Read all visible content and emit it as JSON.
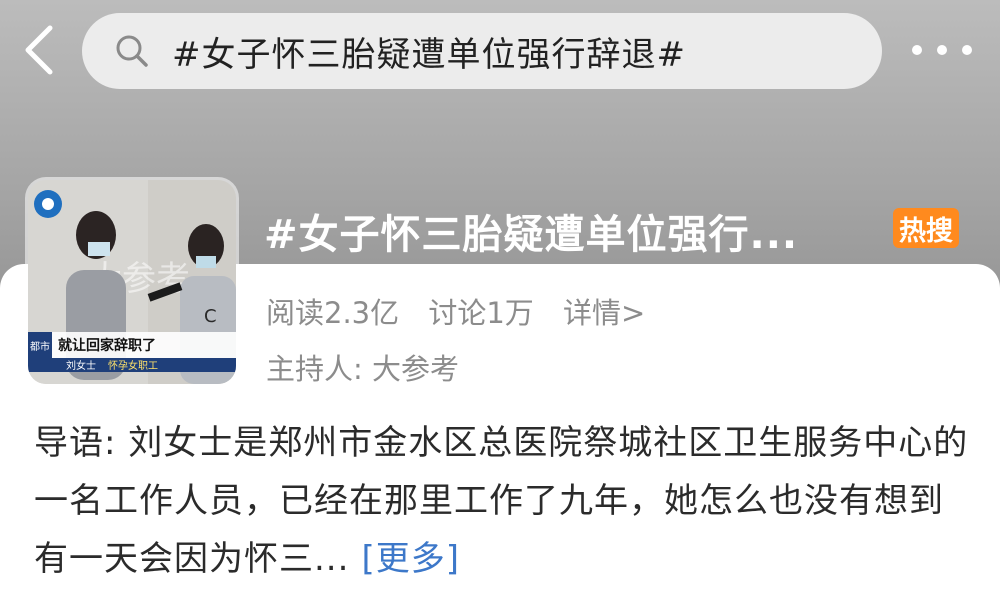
{
  "header": {
    "search_query": "#女子怀三胎疑遭单位强行辞退#"
  },
  "topic": {
    "title": "#女子怀三胎疑遭单位强行...",
    "badge": "热搜",
    "reads": "阅读2.3亿",
    "discussions": "讨论1万",
    "detail_link": "详情>",
    "host": "主持人: 大参考",
    "thumbnail": {
      "caption": "就让回家辞职了",
      "subcaption_name": "刘女士",
      "subcaption_role": "怀孕女职工",
      "watermark": "大参考",
      "logo_text": "都市"
    }
  },
  "intro": {
    "text": "导语: 刘女士是郑州市金水区总医院祭城社区卫生服务中心的一名工作人员，已经在那里工作了九年，她怎么也没有想到有一天会因为怀三...",
    "more_label": "[更多]"
  },
  "colors": {
    "badge": "#ff8a1e",
    "link": "#3d78c9"
  }
}
